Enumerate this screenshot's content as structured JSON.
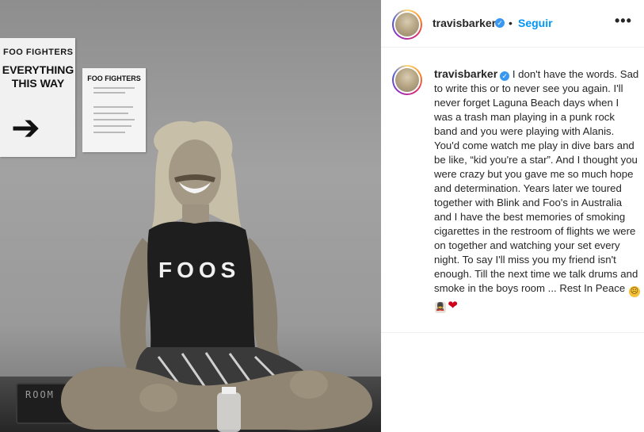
{
  "photo": {
    "sign_left_top": "FOO FIGHTERS",
    "sign_left_main": "EVERYTHING THIS WAY",
    "sign_right_title": "FOO FIGHTERS",
    "shirt_text": "FOOS",
    "mat_text": "ROOM"
  },
  "header": {
    "username": "travisbarker",
    "verified": "✓",
    "dot": "•",
    "follow": "Seguir",
    "more": "•••"
  },
  "caption": {
    "username": "travisbarker",
    "verified": "✓",
    "text": " I don't have the words. Sad to write this or to never see you again. I'll never forget Laguna Beach days when I was a trash man playing in a punk rock band and you were playing with Alanis. You'd come watch me play in dive bars and be like, “kid you're a star”. And I thought you were crazy but you gave me so much hope and determination. Years later we toured together with Blink and Foo's in Australia and I have the best memories of smoking cigarettes in the restroom of flights we were on together and watching your set every night. To say I'll miss you my friend isn't enough. Till the next time we talk drums and smoke in the boys room ... Rest In Peace ",
    "emojis": [
      "☹",
      "💂",
      "❤"
    ]
  }
}
